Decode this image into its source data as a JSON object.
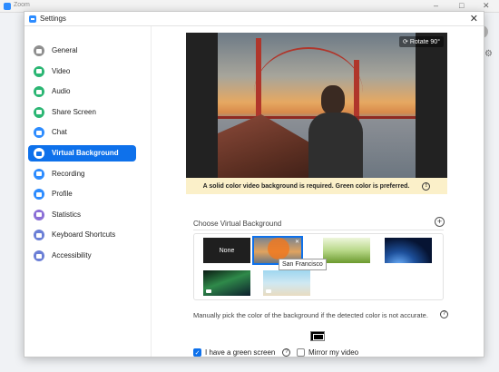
{
  "background_app": {
    "title": "Zoom",
    "controls": [
      "–",
      "□",
      "✕"
    ]
  },
  "dialog": {
    "title": "Settings",
    "close": "✕"
  },
  "sidebar": {
    "items": [
      {
        "label": "General",
        "icon": "gear-icon",
        "color": "#8f8f8f",
        "active": false
      },
      {
        "label": "Video",
        "icon": "video-camera-icon",
        "color": "#2bb673",
        "active": false
      },
      {
        "label": "Audio",
        "icon": "headphones-icon",
        "color": "#2bb673",
        "active": false
      },
      {
        "label": "Share Screen",
        "icon": "share-screen-icon",
        "color": "#2bb673",
        "active": false
      },
      {
        "label": "Chat",
        "icon": "chat-bubble-icon",
        "color": "#2d8cff",
        "active": false
      },
      {
        "label": "Virtual Background",
        "icon": "portrait-icon",
        "color": "#0e71eb",
        "active": true
      },
      {
        "label": "Recording",
        "icon": "record-icon",
        "color": "#2d8cff",
        "active": false
      },
      {
        "label": "Profile",
        "icon": "person-icon",
        "color": "#2d8cff",
        "active": false
      },
      {
        "label": "Statistics",
        "icon": "bar-chart-icon",
        "color": "#8b6fd6",
        "active": false
      },
      {
        "label": "Keyboard Shortcuts",
        "icon": "keyboard-icon",
        "color": "#6b7fd6",
        "active": false
      },
      {
        "label": "Accessibility",
        "icon": "accessibility-icon",
        "color": "#6b7fd6",
        "active": false
      }
    ],
    "active_color": "#0e71eb"
  },
  "preview": {
    "rotate_label": "Rotate 90°",
    "notice": "A solid color video background is required. Green color is preferred."
  },
  "choose": {
    "label": "Choose Virtual Background",
    "add_symbol": "+"
  },
  "thumbnails": [
    {
      "name": "None",
      "text": "None",
      "selected": false
    },
    {
      "name": "San Francisco",
      "text": "",
      "selected": true
    },
    {
      "name": "Grass",
      "text": "",
      "selected": false
    },
    {
      "name": "Earth",
      "text": "",
      "selected": false
    },
    {
      "name": "Aurora",
      "text": "",
      "selected": false
    },
    {
      "name": "Beach",
      "text": "",
      "selected": false
    }
  ],
  "tooltip": "San Francisco",
  "manual": {
    "text": "Manually pick the color of the background if the detected color is not accurate.",
    "swatch_color": "#000000"
  },
  "options": {
    "green_screen_label": "I have a green screen",
    "green_screen_checked": true,
    "mirror_label": "Mirror my video",
    "mirror_checked": false
  }
}
